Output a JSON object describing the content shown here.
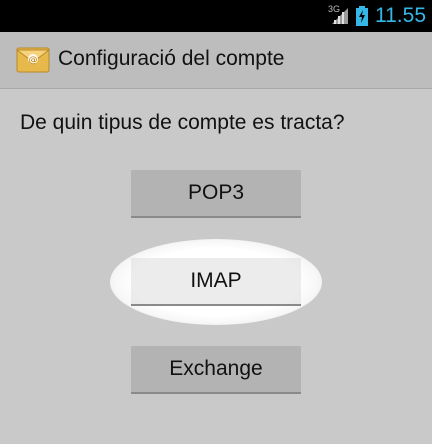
{
  "status_bar": {
    "network": "3G",
    "time": "11.55",
    "colors": {
      "background": "#000000",
      "clock": "#35b7e8"
    },
    "icons": [
      "signal-icon",
      "battery-charging-icon"
    ]
  },
  "action_bar": {
    "title": "Configuració del compte",
    "icon": "email-app-icon"
  },
  "question": "De quin tipus de compte es tracta?",
  "buttons": {
    "pop3": "POP3",
    "imap": "IMAP",
    "exchange": "Exchange"
  },
  "highlighted_option": "IMAP"
}
